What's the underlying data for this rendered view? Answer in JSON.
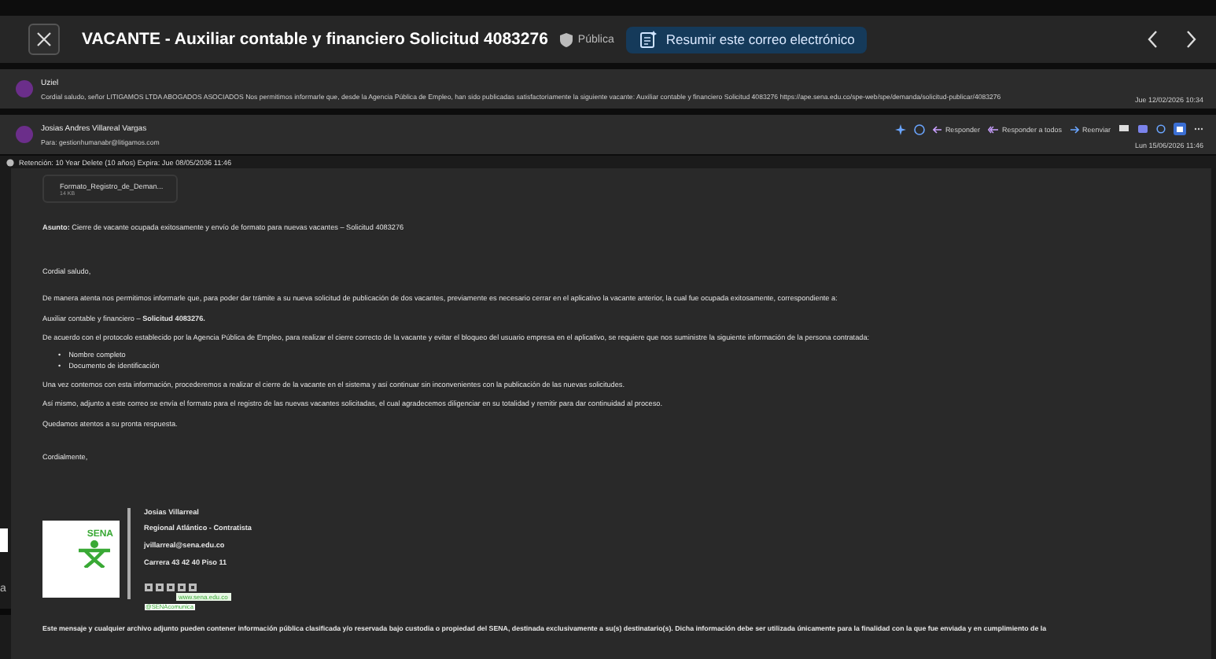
{
  "header": {
    "title": "VACANTE - Auxiliar contable y financiero Solicitud 4083276",
    "sensitivity": "Pública",
    "summarize_button": "Resumir este correo electrónico"
  },
  "thread": [
    {
      "kind": "collapsed",
      "sender": "Uziel",
      "preview": "Cordial saludo, señor LITIGAMOS LTDA ABOGADOS ASOCIADOS Nos permitimos informarle que, desde la Agencia Pública de Empleo, han sido publicadas satisfactoriamente la siguiente vacante: Auxiliar contable y financiero Solicitud 4083276 https://ape.sena.edu.co/spe-web/spe/demanda/solicitud-publicar/4083276",
      "date": "Jue 12/02/2026 10:34"
    },
    {
      "kind": "expanded",
      "sender": "Josias Andres Villareal Vargas",
      "to": "Para: gestionhumanabr@litigamos.com",
      "date": "Lun 15/06/2026 11:46"
    }
  ],
  "actions": [
    "Responder",
    "Responder a todos",
    "Reenviar"
  ],
  "retention": "Retención: 10 Year Delete (10 años) Expira: Jue 08/05/2036 11:46",
  "attachment": {
    "name": "Formato_Registro_de_Deman...",
    "size": "14 KB"
  },
  "body": [
    {
      "kind": "p",
      "text": "**Asunto:** Cierre de vacante ocupada exitosamente y envío de formato para nuevas vacantes – Solicitud 4083276"
    },
    {
      "kind": "p",
      "text": "Cordial saludo,"
    },
    {
      "kind": "p",
      "text": "De manera atenta nos permitimos informarle que, para poder dar trámite a su nueva solicitud de publicación de dos vacantes, previamente es necesario cerrar en el aplicativo la vacante anterior, la cual fue ocupada exitosamente, correspondiente a:"
    },
    {
      "kind": "p",
      "text": "Auxiliar contable y financiero – **Solicitud 4083276.**"
    },
    {
      "kind": "p",
      "text": "De acuerdo con el protocolo establecido por la Agencia Pública de Empleo, para realizar el cierre correcto de la vacante y evitar el bloqueo del usuario empresa en el aplicativo, se requiere que nos suministre la siguiente información de la persona contratada:"
    },
    {
      "kind": "list",
      "marker": "•",
      "items": [
        "Nombre completo",
        "Documento de identificación"
      ]
    },
    {
      "kind": "p",
      "text": "Una vez contemos con esta información, procederemos a realizar el cierre de la vacante en el sistema y así continuar sin inconvenientes con la publicación de las nuevas solicitudes."
    },
    {
      "kind": "p",
      "text": "Así mismo, adjunto a este correo se envía el formato para el registro de las nuevas vacantes solicitadas, el cual agradecemos diligenciar en su totalidad y remitir para dar continuidad al proceso."
    },
    {
      "kind": "p",
      "text": "Quedamos atentos a su pronta respuesta."
    },
    {
      "kind": "p",
      "text": "Cordialmente,"
    }
  ],
  "signature": {
    "name": "Josias Villarreal",
    "role": "Regional Atlántico - Contratista",
    "email": "jvillarreal@sena.edu.co",
    "address": "Carrera 43 42 40 Piso 11",
    "logo": "SENA",
    "website": "www.sena.edu.co",
    "handle": "@SENAcomunica"
  },
  "disclaimer": "Este mensaje y cualquier archivo adjunto pueden contener información pública clasificada y/o reservada bajo custodia o propiedad del SENA, destinada exclusivamente a su(s) destinatario(s). Dicha información debe ser utilizada únicamente para la finalidad con la que fue enviada y en cumplimiento de la",
  "side_fragment": "a"
}
